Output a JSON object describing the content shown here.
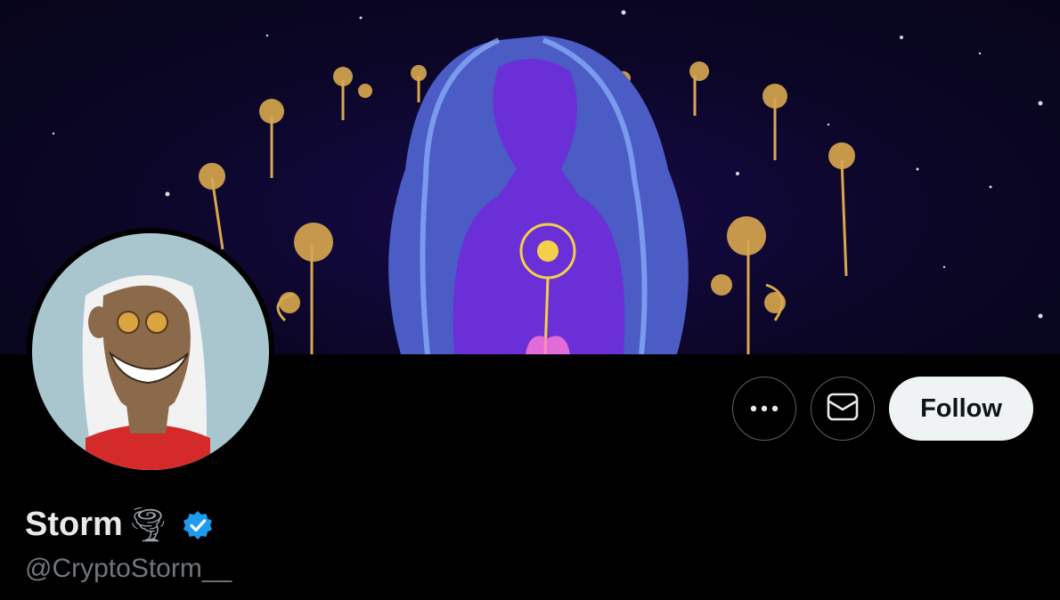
{
  "profile": {
    "display_name": "Storm",
    "name_emoji": "🌪",
    "handle": "@CryptoStorm__",
    "verified": true
  },
  "actions": {
    "more_icon": "more-horizontal-icon",
    "message_icon": "envelope-icon",
    "follow_label": "Follow"
  },
  "colors": {
    "verified_badge": "#1d9bf0",
    "follow_bg": "#eff3f4",
    "handle_text": "#71767b",
    "background": "#000000"
  }
}
